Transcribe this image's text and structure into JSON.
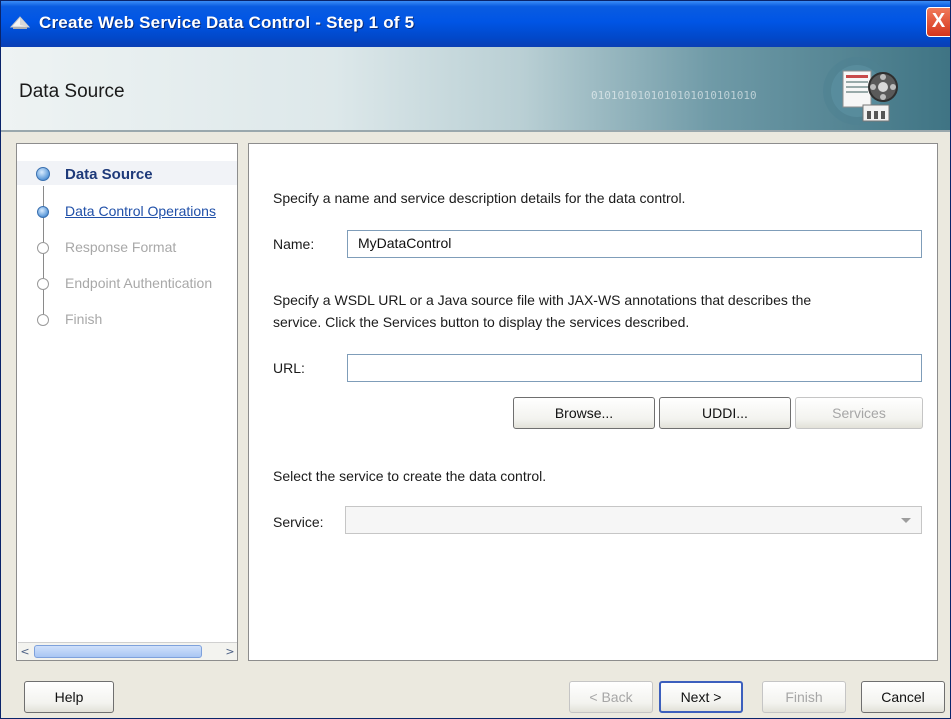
{
  "window": {
    "title": "Create Web Service Data Control - Step 1 of 5",
    "close_label": "X"
  },
  "header": {
    "title": "Data Source",
    "decoration_text": "0101010101010101010101010"
  },
  "train": {
    "steps": [
      {
        "label": "Data Source",
        "state": "current"
      },
      {
        "label": "Data Control Operations",
        "state": "link"
      },
      {
        "label": "Response Format",
        "state": "disabled"
      },
      {
        "label": "Endpoint Authentication",
        "state": "disabled"
      },
      {
        "label": "Finish",
        "state": "disabled"
      }
    ],
    "scroll_left": "<",
    "scroll_right": ">"
  },
  "form": {
    "intro": "Specify a name and service description details for the data control.",
    "name_label": "Name:",
    "name_value": "MyDataControl",
    "wsdl_text_1": "Specify a WSDL URL or a Java source file with JAX-WS annotations that describes the",
    "wsdl_text_2": "service. Click the Services button to display the services described.",
    "url_label": "URL:",
    "url_value": "",
    "browse_label": "Browse...",
    "uddi_label": "UDDI...",
    "services_label": "Services",
    "select_text": "Select the service to create the data control.",
    "service_label": "Service:",
    "service_value": ""
  },
  "footer": {
    "help_label": "Help",
    "back_label": "< Back",
    "next_label": "Next >",
    "finish_label": "Finish",
    "cancel_label": "Cancel"
  },
  "colors": {
    "titlebar": "#0055e5",
    "train_current": "#1e3a7a",
    "train_link": "#1f4fa8",
    "default_button_border": "#3c5fbd"
  },
  "icons": [
    "app-icon",
    "close-icon",
    "banner-logo",
    "train-step-icon",
    "dropdown-arrow-icon"
  ]
}
